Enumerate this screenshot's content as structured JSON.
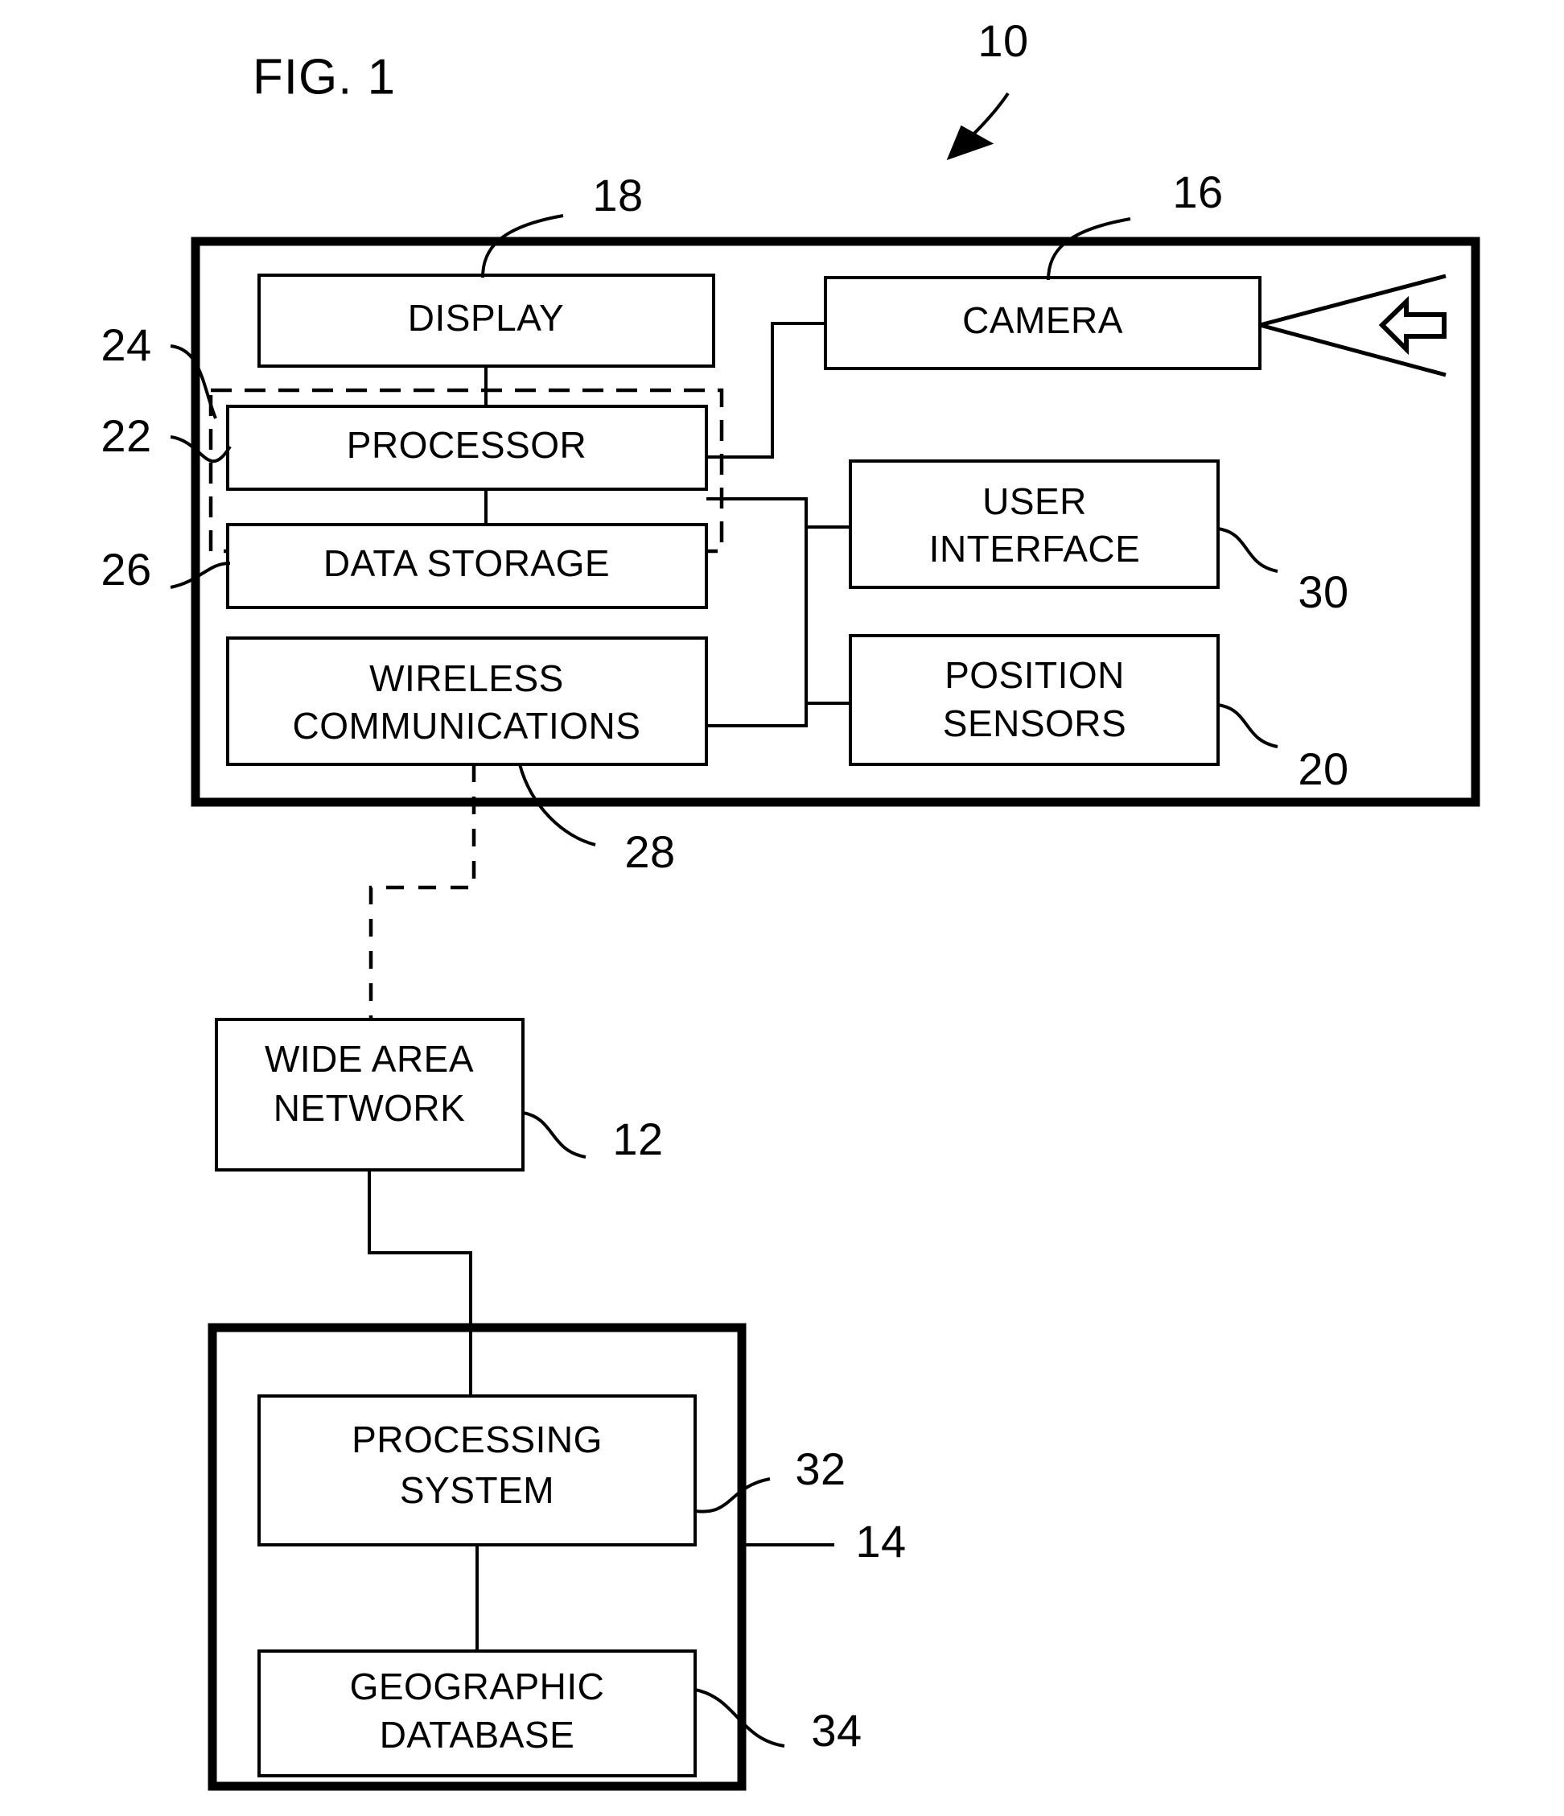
{
  "figure": {
    "title": "FIG. 1",
    "system_numeral": "10"
  },
  "mobile_device": {
    "numeral": "10",
    "components": [
      {
        "id": "display",
        "label": "DISPLAY",
        "numeral": "18"
      },
      {
        "id": "camera",
        "label": "CAMERA",
        "numeral": "16"
      },
      {
        "id": "processor",
        "label": "PROCESSOR",
        "numeral": "22"
      },
      {
        "id": "storage",
        "label": "DATA STORAGE",
        "numeral": "26"
      },
      {
        "id": "wireless",
        "label_line1": "WIRELESS",
        "label_line2": "COMMUNICATIONS",
        "numeral": "28"
      },
      {
        "id": "ui",
        "label_line1": "USER",
        "label_line2": "INTERFACE",
        "numeral": "30"
      },
      {
        "id": "sensors",
        "label_line1": "POSITION",
        "label_line2": "SENSORS",
        "numeral": "20"
      }
    ],
    "computing_platform_numeral": "24"
  },
  "network": {
    "label_line1": "WIDE AREA",
    "label_line2": "NETWORK",
    "numeral": "12"
  },
  "server": {
    "numeral": "14",
    "components": [
      {
        "id": "procsys",
        "label_line1": "PROCESSING",
        "label_line2": "SYSTEM",
        "numeral": "32"
      },
      {
        "id": "geodb",
        "label_line1": "GEOGRAPHIC",
        "label_line2": "DATABASE",
        "numeral": "34"
      }
    ]
  },
  "labels": {
    "display": "DISPLAY",
    "camera": "CAMERA",
    "processor": "PROCESSOR",
    "data_storage": "DATA STORAGE",
    "wireless_1": "WIRELESS",
    "wireless_2": "COMMUNICATIONS",
    "user_interface_1": "USER",
    "user_interface_2": "INTERFACE",
    "position_sensors_1": "POSITION",
    "position_sensors_2": "SENSORS",
    "wan_1": "WIDE AREA",
    "wan_2": "NETWORK",
    "processing_system_1": "PROCESSING",
    "processing_system_2": "SYSTEM",
    "geographic_database_1": "GEOGRAPHIC",
    "geographic_database_2": "DATABASE"
  },
  "numerals": {
    "n10": "10",
    "n12": "12",
    "n14": "14",
    "n16": "16",
    "n18": "18",
    "n20": "20",
    "n22": "22",
    "n24": "24",
    "n26": "26",
    "n28": "28",
    "n30": "30",
    "n32": "32",
    "n34": "34"
  },
  "colors": {
    "ink": "#000000",
    "paper": "#ffffff"
  }
}
